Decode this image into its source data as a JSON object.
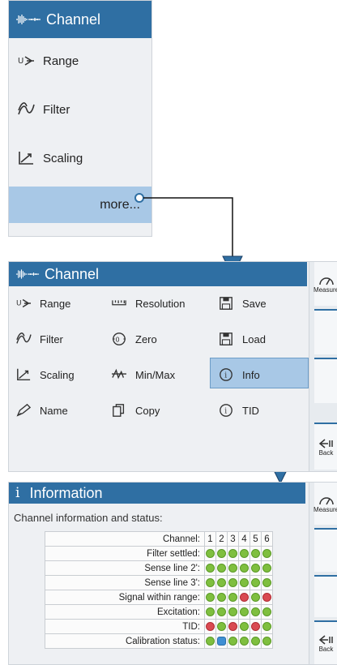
{
  "panel1": {
    "title": "Channel",
    "items": [
      {
        "label": "Range",
        "icon": "range-icon"
      },
      {
        "label": "Filter",
        "icon": "filter-icon"
      },
      {
        "label": "Scaling",
        "icon": "scaling-icon"
      }
    ],
    "more_label": "more..."
  },
  "panel2": {
    "title": "Channel",
    "col1": [
      {
        "label": "Range",
        "icon": "range-icon"
      },
      {
        "label": "Filter",
        "icon": "filter-icon"
      },
      {
        "label": "Scaling",
        "icon": "scaling-icon"
      },
      {
        "label": "Name",
        "icon": "pen-icon"
      }
    ],
    "col2": [
      {
        "label": "Resolution",
        "icon": "ruler-icon"
      },
      {
        "label": "Zero",
        "icon": "zero-icon"
      },
      {
        "label": "Min/Max",
        "icon": "minmax-icon"
      },
      {
        "label": "Copy",
        "icon": "copy-icon"
      }
    ],
    "col3": [
      {
        "label": "Save",
        "icon": "save-icon"
      },
      {
        "label": "Load",
        "icon": "load-icon"
      },
      {
        "label": "Info",
        "icon": "info-icon"
      },
      {
        "label": "TID",
        "icon": "info-icon"
      }
    ]
  },
  "sidebar": {
    "measure_label": "Measure",
    "back_label": "Back"
  },
  "panel3": {
    "title": "Information",
    "subtitle": "Channel information and status:",
    "header": {
      "label": "Channel:",
      "channels": [
        "1",
        "2",
        "3",
        "4",
        "5",
        "6"
      ]
    },
    "rows": [
      {
        "label": "Filter settled:",
        "status": [
          "ok",
          "ok",
          "ok",
          "ok",
          "ok",
          "ok"
        ]
      },
      {
        "label": "Sense line 2':",
        "status": [
          "ok",
          "ok",
          "ok",
          "ok",
          "ok",
          "ok"
        ]
      },
      {
        "label": "Sense line 3':",
        "status": [
          "ok",
          "ok",
          "ok",
          "ok",
          "ok",
          "ok"
        ]
      },
      {
        "label": "Signal within range:",
        "status": [
          "ok",
          "ok",
          "ok",
          "err",
          "ok",
          "err"
        ]
      },
      {
        "label": "Excitation:",
        "status": [
          "ok",
          "ok",
          "ok",
          "ok",
          "ok",
          "ok"
        ]
      },
      {
        "label": "TID:",
        "status": [
          "err",
          "ok",
          "err",
          "ok",
          "err",
          "ok"
        ]
      },
      {
        "label": "Calibration status:",
        "status": [
          "ok",
          "busy",
          "ok",
          "ok",
          "ok",
          "ok"
        ]
      }
    ]
  },
  "colors": {
    "title_bar": "#2f6fa3",
    "highlight": "#a8c8e6",
    "ok": "#7fbf3f",
    "error": "#d94a52",
    "busy": "#3f8fd3"
  }
}
